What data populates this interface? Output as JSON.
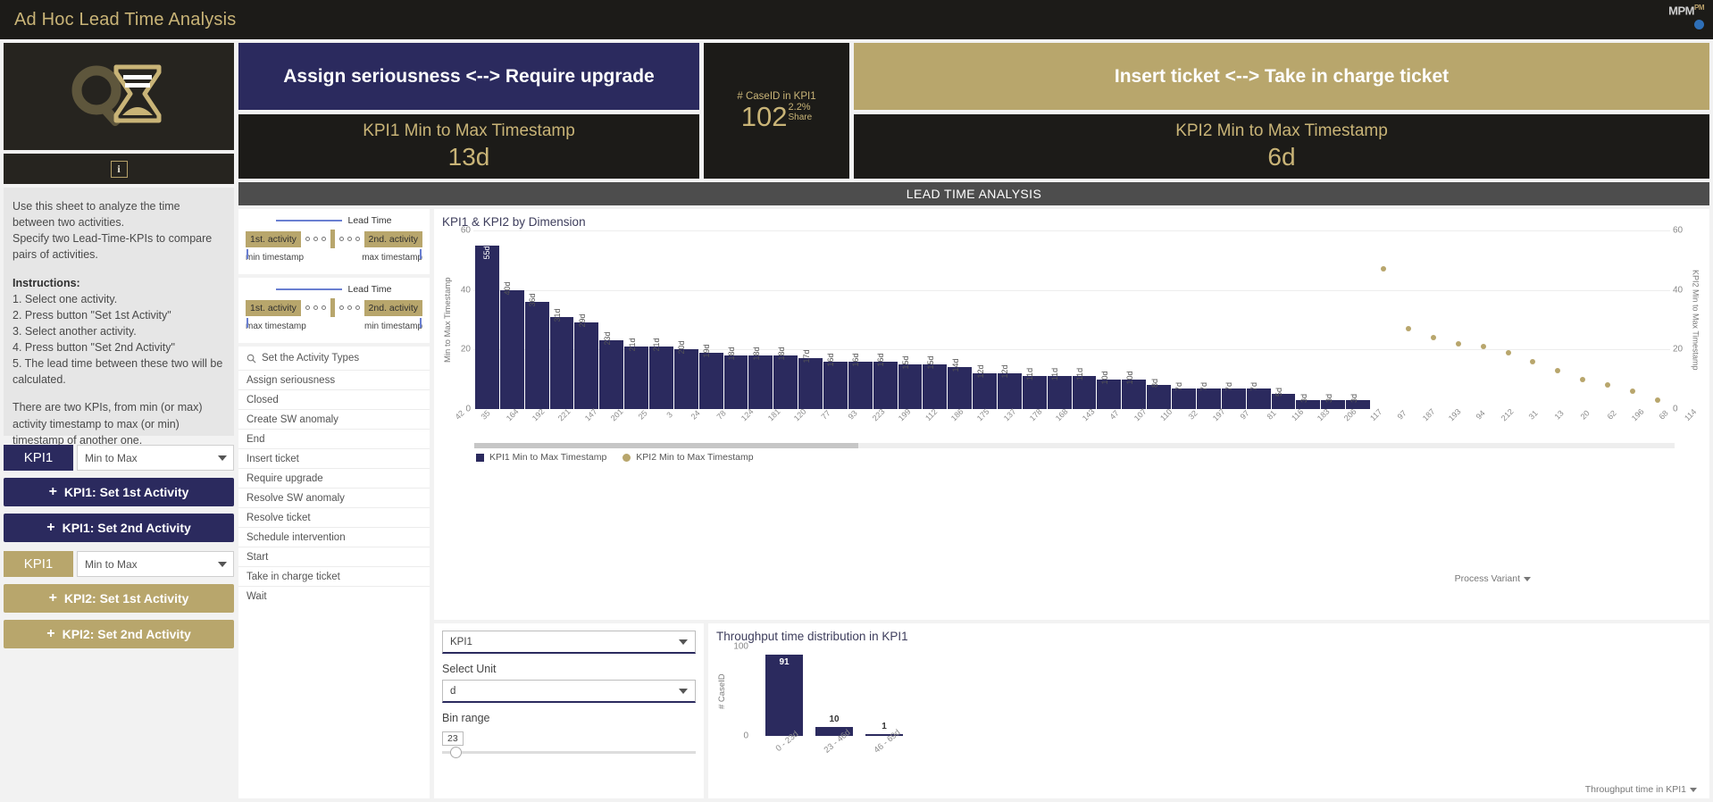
{
  "topbar": {
    "title": "Ad Hoc Lead Time Analysis",
    "brand": "MPM",
    "brand_sup": "PM"
  },
  "left_panel": {
    "logo_icon": "magnifier-hourglass-icon",
    "info_icon": "info-icon",
    "instructions": {
      "intro_1": "Use this sheet to analyze the time between two activities.",
      "intro_2": "Specify two Lead-Time-KPIs to compare pairs of activities.",
      "heading": "Instructions:",
      "steps": [
        "1. Select one activity.",
        "2. Press button \"Set 1st Activity\"",
        "3. Select another activity.",
        "4. Press button \"Set 2nd Activity\"",
        "5. The lead time between these two will be calculated."
      ],
      "outro": "There are two KPIs, from min (or max) activity timestamp to max (or min) timestamp of another one."
    },
    "kpi1": {
      "tag": "KPI1",
      "select_value": "Min to Max",
      "btn_first": "KPI1: Set 1st Activity",
      "btn_second": "KPI1: Set 2nd Activity"
    },
    "kpi2": {
      "tag": "KPI1",
      "select_value": "Min to Max",
      "btn_first": "KPI2: Set 1st Activity",
      "btn_second": "KPI2: Set 2nd Activity"
    }
  },
  "header_cards": {
    "kpi1_variant": "Assign seriousness <--> Require upgrade",
    "kpi1_ts_title": "KPI1 Min to Max Timestamp",
    "kpi1_ts_value": "13d",
    "kpi2_variant": "Insert ticket <--> Take in charge ticket",
    "kpi2_ts_title": "KPI2 Min to Max Timestamp",
    "kpi2_ts_value": "6d",
    "case_title": "# CaseID in KPI1",
    "case_value": "102",
    "case_pct": "2.2%",
    "case_share_label": "Share"
  },
  "section_title": "LEAD TIME ANALYSIS",
  "lead_time_diagrams": [
    {
      "header": "Lead Time",
      "chip_left": "1st. activity",
      "chip_right": "2nd. activity",
      "foot_left": "min timestamp",
      "foot_right": "max timestamp"
    },
    {
      "header": "Lead Time",
      "chip_left": "1st. activity",
      "chip_right": "2nd. activity",
      "foot_left": "max timestamp",
      "foot_right": "min timestamp"
    }
  ],
  "activity_panel": {
    "search_placeholder": "Set the Activity Types",
    "search_icon": "search-icon",
    "items": [
      "Assign seriousness",
      "Closed",
      "Create SW anomaly",
      "End",
      "Insert ticket",
      "Require upgrade",
      "Resolve SW anomaly",
      "Resolve ticket",
      "Schedule intervention",
      "Start",
      "Take in charge ticket",
      "Wait"
    ]
  },
  "controls": {
    "kpi_select_value": "KPI1",
    "unit_label": "Select Unit",
    "unit_select_value": "d",
    "bin_label": "Bin range",
    "bin_value": "23"
  },
  "chart_data": [
    {
      "type": "bar",
      "title": "KPI1 & KPI2 by Dimension",
      "xlabel": "Process Variant",
      "ylabel": "Min to Max Timestamp",
      "y2label": "KPI2 Min to Max Timestamp",
      "ylim": [
        0,
        60
      ],
      "yticks": [
        0,
        20,
        40,
        60
      ],
      "y2ticks": [
        0,
        20,
        40,
        60
      ],
      "grid": true,
      "legend_position": "bottom-left",
      "legend": [
        "KPI1 Min to Max Timestamp",
        "KPI2 Min to Max Timestamp"
      ],
      "categories": [
        "42",
        "35",
        "164",
        "192",
        "221",
        "147",
        "201",
        "25",
        "3",
        "24",
        "78",
        "124",
        "181",
        "120",
        "77",
        "93",
        "223",
        "199",
        "112",
        "186",
        "175",
        "137",
        "178",
        "168",
        "143",
        "47",
        "107",
        "110",
        "32",
        "197",
        "97",
        "81",
        "116",
        "183",
        "206",
        "117",
        "97",
        "187",
        "193",
        "94",
        "212",
        "31",
        "13",
        "20",
        "62",
        "196",
        "68",
        "114"
      ],
      "series": [
        {
          "name": "KPI1 Min to Max Timestamp",
          "labels": [
            "55d",
            "40d",
            "36d",
            "31d",
            "29d",
            "23d",
            "21d",
            "21d",
            "20d",
            "19d",
            "18d",
            "18d",
            "18d",
            "17d",
            "16d",
            "16d",
            "16d",
            "15d",
            "15d",
            "14d",
            "12d",
            "12d",
            "11d",
            "11d",
            "11d",
            "10d",
            "10d",
            "8d",
            "7d",
            "7d",
            "7d",
            "7d",
            "5d",
            "3d",
            "3d",
            "3d",
            "",
            "",
            "",
            "",
            "",
            "",
            "",
            "",
            "",
            "",
            "",
            ""
          ],
          "values": [
            55,
            40,
            36,
            31,
            29,
            23,
            21,
            21,
            20,
            19,
            18,
            18,
            18,
            17,
            16,
            16,
            16,
            15,
            15,
            14,
            12,
            12,
            11,
            11,
            11,
            10,
            10,
            8,
            7,
            7,
            7,
            7,
            5,
            3,
            3,
            3,
            0,
            0,
            0,
            0,
            0,
            0,
            0,
            0,
            0,
            0,
            0,
            0
          ]
        },
        {
          "name": "KPI2 Min to Max Timestamp",
          "type": "scatter",
          "points": [
            {
              "x": 36,
              "y": 47
            },
            {
              "x": 37,
              "y": 27
            },
            {
              "x": 38,
              "y": 24
            },
            {
              "x": 39,
              "y": 22
            },
            {
              "x": 40,
              "y": 21
            },
            {
              "x": 41,
              "y": 19
            },
            {
              "x": 42,
              "y": 16
            },
            {
              "x": 43,
              "y": 13
            },
            {
              "x": 44,
              "y": 10
            },
            {
              "x": 45,
              "y": 8
            },
            {
              "x": 46,
              "y": 6
            },
            {
              "x": 47,
              "y": 3
            }
          ]
        }
      ]
    },
    {
      "type": "bar",
      "title": "Throughput time distribution in KPI1",
      "xlabel": "Throughput time in KPI1",
      "ylabel": "# CaseID",
      "ylim": [
        0,
        100
      ],
      "yticks": [
        0,
        100
      ],
      "categories": [
        "0 - 23d",
        "23 - 46d",
        "46 - 69d"
      ],
      "values": [
        91,
        10,
        1
      ],
      "labels": [
        "91",
        "10",
        "1"
      ]
    }
  ]
}
